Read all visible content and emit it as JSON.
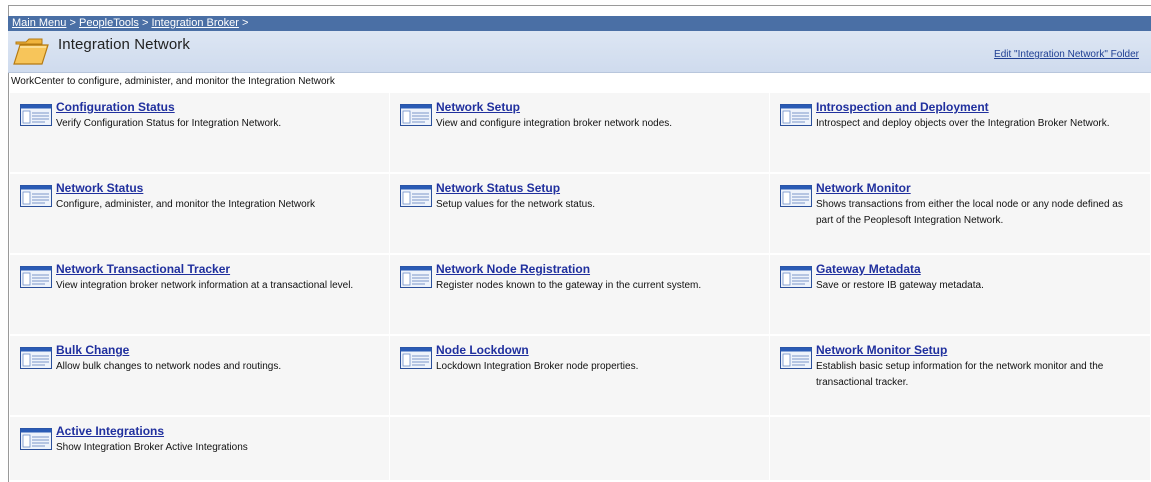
{
  "breadcrumb": {
    "items": [
      "Main Menu",
      "PeopleTools",
      "Integration Broker"
    ],
    "separator": ">"
  },
  "header": {
    "title": "Integration Network",
    "icon": "folder-icon",
    "edit_link": "Edit \"Integration Network\" Folder"
  },
  "description": "WorkCenter to configure, administer, and monitor the Integration Network",
  "items": [
    {
      "title": "Configuration Status",
      "desc": "Verify Configuration Status for Integration Network."
    },
    {
      "title": "Network Setup",
      "desc": "View and configure integration broker network nodes."
    },
    {
      "title": "Introspection and Deployment",
      "desc": "Introspect and deploy objects over the Integration Broker Network."
    },
    {
      "title": "Network Status",
      "desc": "Configure, administer, and monitor the Integration Network"
    },
    {
      "title": "Network Status Setup",
      "desc": "Setup values for the network status."
    },
    {
      "title": "Network Monitor",
      "desc": "Shows transactions from either the local node or any node defined as part of the Peoplesoft Integration Network."
    },
    {
      "title": "Network Transactional Tracker",
      "desc": "View integration broker network information at a transactional level."
    },
    {
      "title": "Network Node Registration",
      "desc": "Register nodes known to the gateway in the current system."
    },
    {
      "title": "Gateway Metadata",
      "desc": "Save or restore IB gateway metadata."
    },
    {
      "title": "Bulk Change",
      "desc": "Allow bulk changes to network nodes and routings."
    },
    {
      "title": "Node Lockdown",
      "desc": "Lockdown Integration Broker node properties."
    },
    {
      "title": "Network Monitor Setup",
      "desc": "Establish basic setup information for the network monitor and the transactional tracker."
    },
    {
      "title": "Active Integrations",
      "desc": "Show Integration Broker Active Integrations"
    }
  ],
  "colors": {
    "breadcrumb_bar": "#4a6fa5",
    "header_bg": "#d6e0ef",
    "link": "#20309e",
    "cell_bg": "#f6f6f6"
  }
}
